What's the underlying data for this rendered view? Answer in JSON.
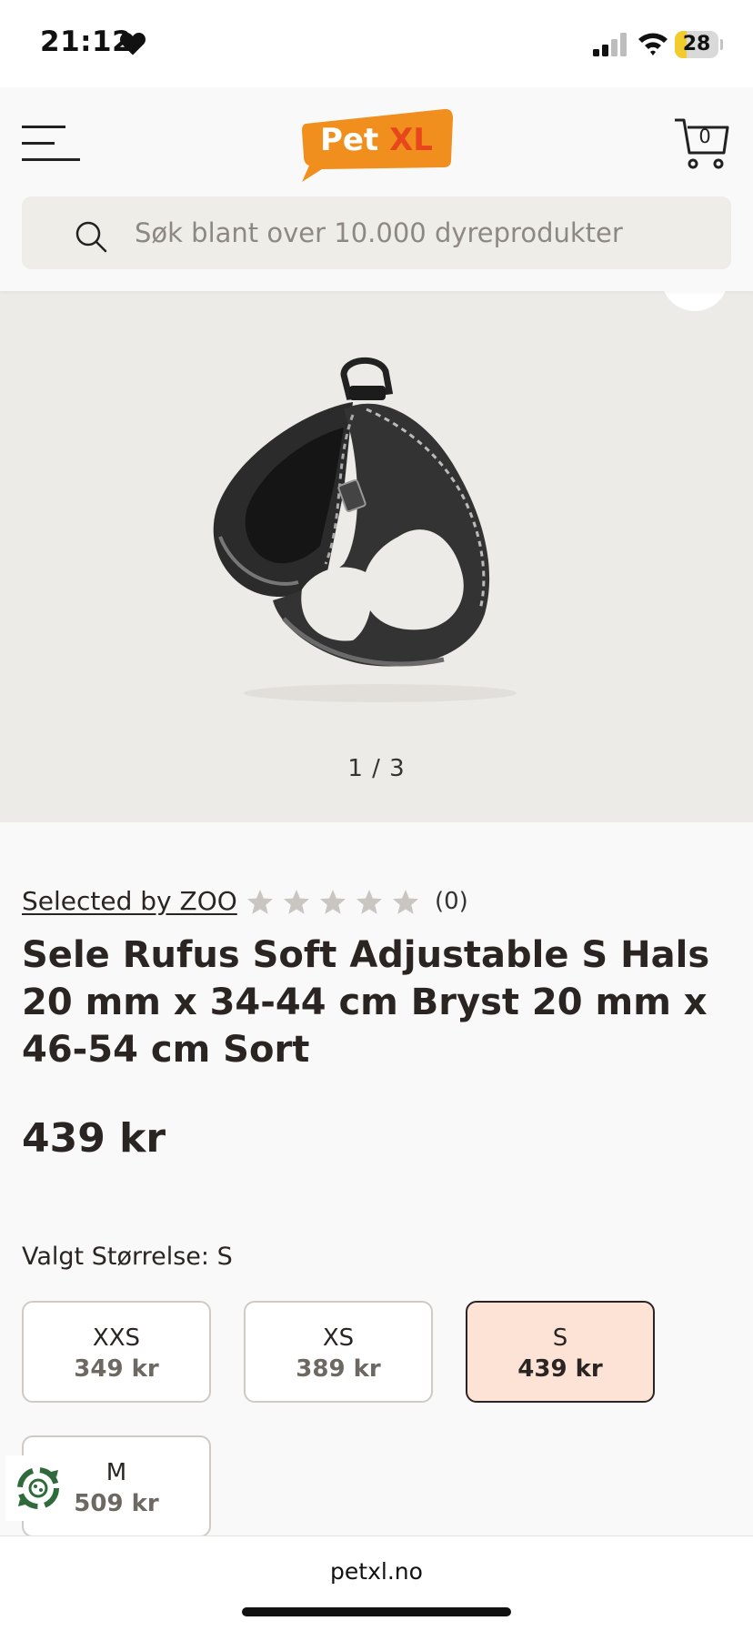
{
  "status_bar": {
    "time": "21:12",
    "battery": "28",
    "battery_level": 0.28,
    "icons": [
      "heart-icon",
      "signal-icon",
      "wifi-icon"
    ]
  },
  "header": {
    "menu_icon": "hamburger-menu-icon",
    "logo": {
      "pet": "Pet",
      "xl": "XL",
      "bg_color": "#f18f1e",
      "xl_color": "#e8471d"
    },
    "cart_count": "0",
    "search_placeholder": "Søk blant over 10.000 dyreprodukter"
  },
  "gallery": {
    "counter": "1 / 3",
    "bg_color": "#edebe7"
  },
  "product": {
    "brand": "Selected by ZOO",
    "rating_stars": 0,
    "rating_max": 5,
    "review_count": "(0)",
    "title": "Sele Rufus Soft Adjustable S Hals 20 mm x 34-44 cm Bryst 20 mm x 46-54 cm Sort",
    "price": "439 kr",
    "size_label": "Valgt Størrelse: S",
    "sizes": [
      {
        "name": "XXS",
        "price": "349 kr",
        "selected": false
      },
      {
        "name": "XS",
        "price": "389 kr",
        "selected": false
      },
      {
        "name": "S",
        "price": "439 kr",
        "selected": true
      },
      {
        "name": "M",
        "price": "509 kr",
        "selected": false
      }
    ],
    "selected_color": "#fde3d5"
  },
  "browser": {
    "url": "petxl.no"
  }
}
